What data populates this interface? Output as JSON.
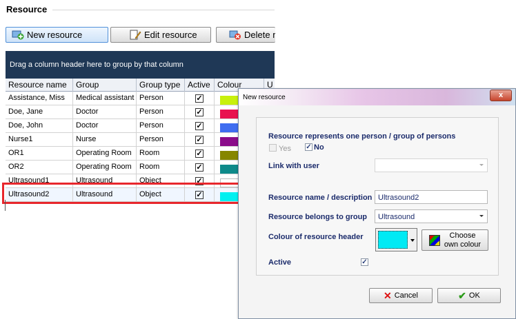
{
  "section": {
    "title": "Resource"
  },
  "toolbar": {
    "new_label": "New resource",
    "edit_label": "Edit resource",
    "delete_label": "Delete r"
  },
  "grid": {
    "group_hint": "Drag a column header here to group by that column",
    "columns": [
      "Resource name",
      "Group",
      "Group type",
      "Active",
      "Colour",
      "U"
    ],
    "rows": [
      {
        "name": "Assistance, Miss",
        "group": "Medical assistant",
        "type": "Person",
        "active": "✓",
        "colour": "#c8f00c"
      },
      {
        "name": "Doe, Jane",
        "group": "Doctor",
        "type": "Person",
        "active": "✓",
        "colour": "#e8124f"
      },
      {
        "name": "Doe, John",
        "group": "Doctor",
        "type": "Person",
        "active": "✓",
        "colour": "#3f6df0"
      },
      {
        "name": "Nurse1",
        "group": "Nurse",
        "type": "Person",
        "active": "✓",
        "colour": "#8a0c8a"
      },
      {
        "name": "OR1",
        "group": "Operating Room",
        "type": "Room",
        "active": "✓",
        "colour": "#868600"
      },
      {
        "name": "OR2",
        "group": "Operating Room",
        "type": "Room",
        "active": "✓",
        "colour": "#0e8a8a"
      },
      {
        "name": "Ultrasound1",
        "group": "Ultrasound",
        "type": "Object",
        "active": "✓",
        "colour": "#ffffff"
      },
      {
        "name": "Ultrasound2",
        "group": "Ultrasound",
        "type": "Object",
        "active": "✓",
        "colour": "#00f0f0"
      }
    ],
    "selected_index": 7
  },
  "dialog": {
    "title": "New resource",
    "close_label": "x",
    "represents_label": "Resource represents one person / group of persons",
    "yes_label": "Yes",
    "no_label": "No",
    "link_user_label": "Link with user",
    "link_user_value": "",
    "name_label": "Resource name / description",
    "name_value": "Ultrasound2",
    "group_label": "Resource belongs to group",
    "group_value": "Ultrasound",
    "colour_label": "Colour of resource header",
    "colour_value": "#00eaf4",
    "choose_line1": "Choose",
    "choose_line2": "own colour",
    "active_label": "Active",
    "active_checked": "✓",
    "no_checked": "✓",
    "cancel_label": "Cancel",
    "ok_label": "OK"
  }
}
